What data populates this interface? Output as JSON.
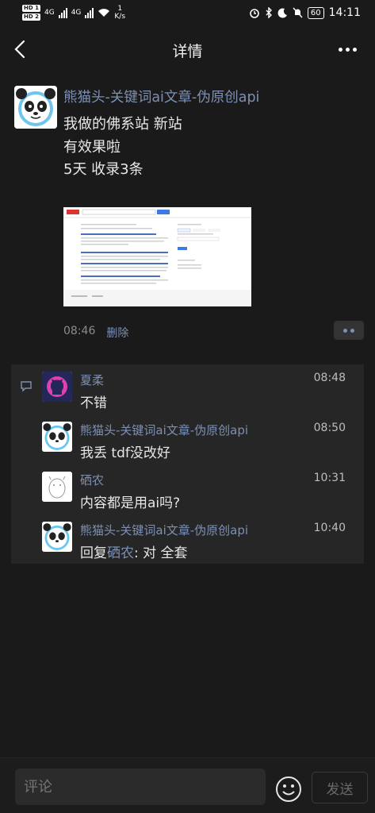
{
  "status_bar": {
    "sim1": "HD 1",
    "sim2": "HD 2",
    "net1": "4G",
    "net2": "4G",
    "speed_value": "1",
    "speed_unit": "K/s",
    "battery": "60",
    "time": "14:11"
  },
  "nav": {
    "title": "详情",
    "back_icon": "back-chevron-icon",
    "more_icon": "more-dots-icon"
  },
  "post": {
    "author": "熊猫头-关键词ai文章-伪原创api",
    "lines": [
      "我做的佛系站 新站",
      "有效果啦",
      "5天 收录3条"
    ],
    "image": "search-results-screenshot",
    "time": "08:46",
    "delete_label": "删除"
  },
  "comments": [
    {
      "name": "夏柔",
      "time": "08:48",
      "text": "不错",
      "avatar": "github-octocat-avatar"
    },
    {
      "name": "熊猫头-关键词ai文章-伪原创api",
      "time": "08:50",
      "text": "我丢 tdf没改好",
      "avatar": "panda-avatar"
    },
    {
      "name": "硒农",
      "time": "10:31",
      "text": "内容都是用ai吗?",
      "avatar": "sketch-avatar"
    },
    {
      "name": "熊猫头-关键词ai文章-伪原创api",
      "time": "10:40",
      "reply_prefix": "回复",
      "reply_to": "硒农",
      "reply_text": ": 对 全套",
      "avatar": "panda-avatar"
    }
  ],
  "input": {
    "placeholder": "评论",
    "send_label": "发送",
    "emoji_icon": "smiley-icon"
  },
  "colors": {
    "background": "#1a1a1a",
    "name_blue": "#7d90b3",
    "comment_panel": "#262626"
  }
}
